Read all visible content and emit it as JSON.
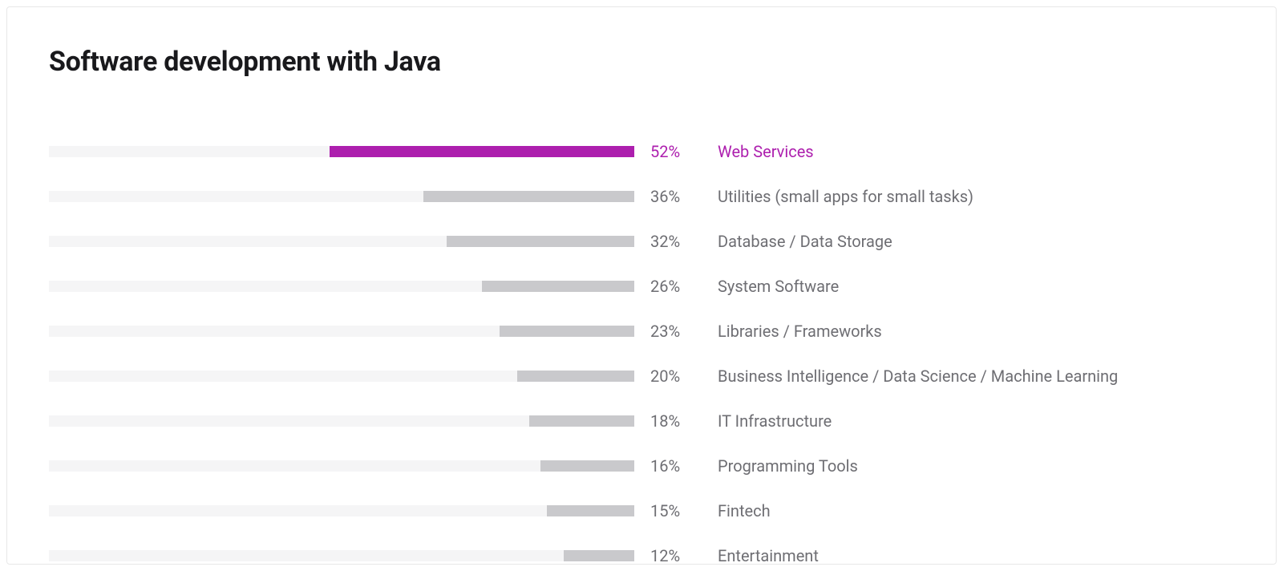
{
  "title": "Software development with Java",
  "colors": {
    "highlight": "#ad1fae",
    "bar": "#c9c9cc",
    "track": "#f5f5f6",
    "text_muted": "#6e6e73"
  },
  "chart_data": {
    "type": "bar",
    "title": "Software development with Java",
    "xlabel": "",
    "ylabel": "",
    "xlim": [
      0,
      100
    ],
    "categories": [
      "Web Services",
      "Utilities (small apps for small tasks)",
      "Database / Data Storage",
      "System Software",
      "Libraries / Frameworks",
      "Business Intelligence / Data Science /  Machine Learning",
      "IT Infrastructure",
      "Programming Tools",
      "Fintech",
      "Entertainment"
    ],
    "values": [
      52,
      36,
      32,
      26,
      23,
      20,
      18,
      16,
      15,
      12
    ],
    "highlight_index": 0
  },
  "rows": [
    {
      "pct": "52%",
      "label": "Web Services"
    },
    {
      "pct": "36%",
      "label": "Utilities (small apps for small tasks)"
    },
    {
      "pct": "32%",
      "label": "Database / Data Storage"
    },
    {
      "pct": "26%",
      "label": "System Software"
    },
    {
      "pct": "23%",
      "label": "Libraries / Frameworks"
    },
    {
      "pct": "20%",
      "label": "Business Intelligence / Data Science /  Machine Learning"
    },
    {
      "pct": "18%",
      "label": "IT Infrastructure"
    },
    {
      "pct": "16%",
      "label": "Programming Tools"
    },
    {
      "pct": "15%",
      "label": "Fintech"
    },
    {
      "pct": "12%",
      "label": "Entertainment"
    }
  ]
}
